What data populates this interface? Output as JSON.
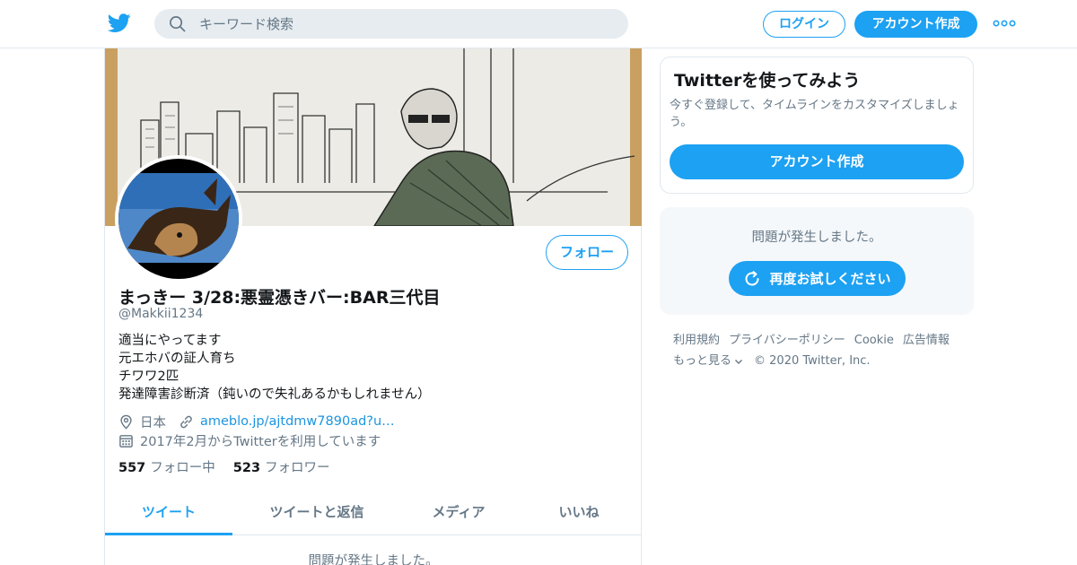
{
  "colors": {
    "accent": "#1da1f2",
    "text": "#14171a",
    "muted": "#657786",
    "border": "#e1e8ed",
    "link": "#1b95e0"
  },
  "header": {
    "search_placeholder": "キーワード検索",
    "login_label": "ログイン",
    "signup_label": "アカウント作成"
  },
  "profile": {
    "follow_label": "フォロー",
    "name": "まっきー 3/28:悪霊憑きバー:BAR三代目",
    "handle": "@Makkii1234",
    "bio": [
      "適当にやってます",
      "元エホバの証人育ち",
      "チワワ2匹",
      "発達障害診断済（鈍いので失礼あるかもしれません）"
    ],
    "location": "日本",
    "url": "ameblo.jp/ajtdmw7890ad?u…",
    "joined": "2017年2月からTwitterを利用しています",
    "following_count": "557",
    "following_label": "フォロー中",
    "followers_count": "523",
    "followers_label": "フォロワー",
    "tabs": [
      "ツイート",
      "ツイートと返信",
      "メディア",
      "いいね"
    ],
    "error_text": "問題が発生しました。"
  },
  "sidebar": {
    "signup_card": {
      "title": "Twitterを使ってみよう",
      "description": "今すぐ登録して、タイムラインをカスタマイズしましょう。",
      "button": "アカウント作成"
    },
    "error_card": {
      "message": "問題が発生しました。",
      "retry_button": "再度お試しください"
    },
    "footer": {
      "links": [
        "利用規約",
        "プライバシーポリシー",
        "Cookie",
        "広告情報"
      ],
      "more": "もっと見る",
      "copyright": "© 2020 Twitter, Inc."
    }
  }
}
